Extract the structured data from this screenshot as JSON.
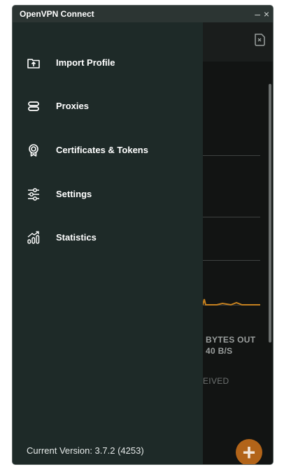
{
  "window": {
    "title": "OpenVPN Connect",
    "minimize_glyph": "–",
    "close_glyph": "×"
  },
  "drawer": {
    "items": [
      {
        "label": "Import Profile",
        "icon": "import-icon"
      },
      {
        "label": "Proxies",
        "icon": "proxies-icon"
      },
      {
        "label": "Certificates & Tokens",
        "icon": "certificate-icon"
      },
      {
        "label": "Settings",
        "icon": "settings-sliders-icon"
      },
      {
        "label": "Statistics",
        "icon": "statistics-icon"
      }
    ],
    "version": "Current Version: 3.7.2 (4253)"
  },
  "main": {
    "bytes_out_label": "BYTES OUT",
    "bytes_out_value": "40 B/S",
    "received_partial": "EIVED",
    "add_glyph": "+"
  },
  "colors": {
    "drawer_bg": "#1e2a28",
    "accent_orange": "#b26419"
  }
}
